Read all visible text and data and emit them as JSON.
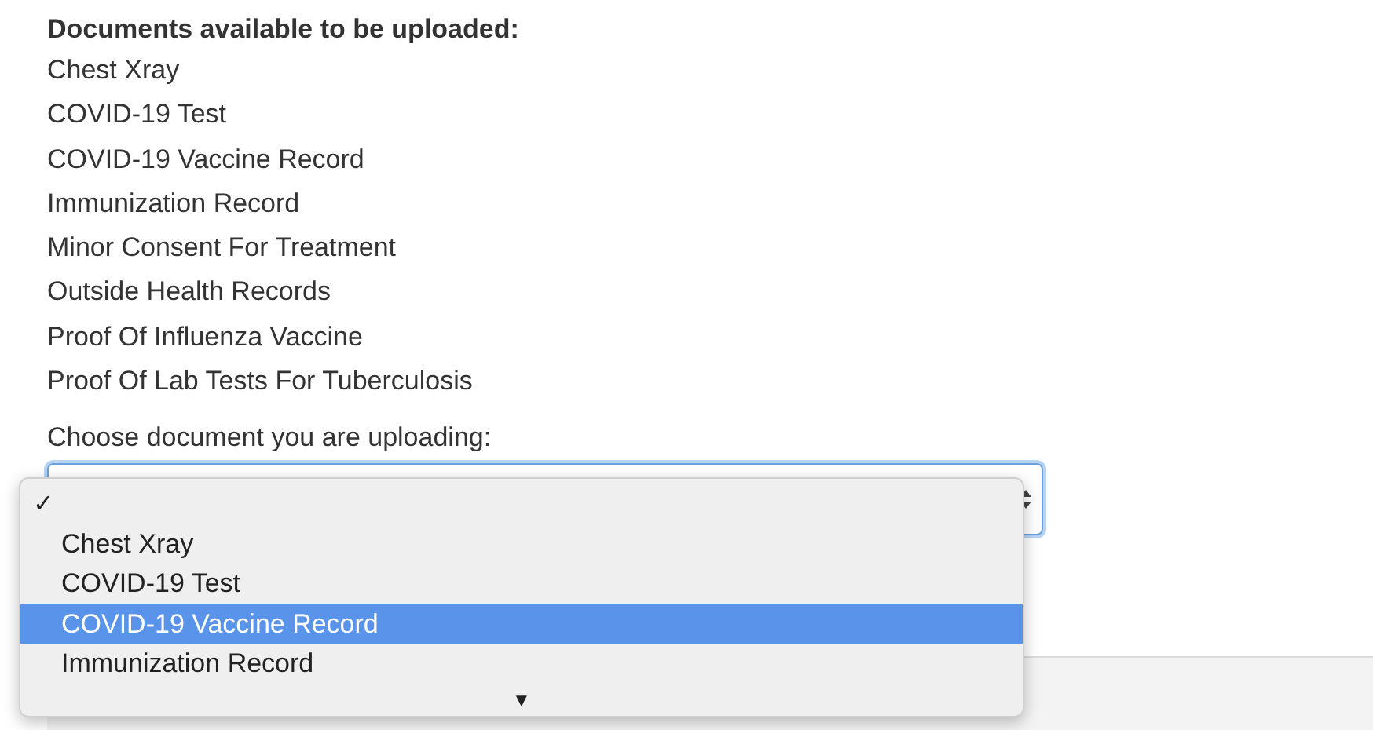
{
  "documents_heading": "Documents available to be uploaded:",
  "documents": [
    "Chest Xray",
    "COVID-19 Test",
    "COVID-19 Vaccine Record",
    "Immunization Record",
    "Minor Consent For Treatment",
    "Outside Health Records",
    "Proof Of Influenza Vaccine",
    "Proof Of Lab Tests For Tuberculosis"
  ],
  "choose_label": "Choose document you are uploading:",
  "select": {
    "focused": true,
    "dropdown": {
      "check_mark": "✓",
      "options": [
        {
          "label": "Chest Xray",
          "highlighted": false
        },
        {
          "label": "COVID-19 Test",
          "highlighted": false
        },
        {
          "label": "COVID-19 Vaccine Record",
          "highlighted": true
        },
        {
          "label": "Immunization Record",
          "highlighted": false
        }
      ],
      "scroll_arrow": "▼"
    }
  }
}
